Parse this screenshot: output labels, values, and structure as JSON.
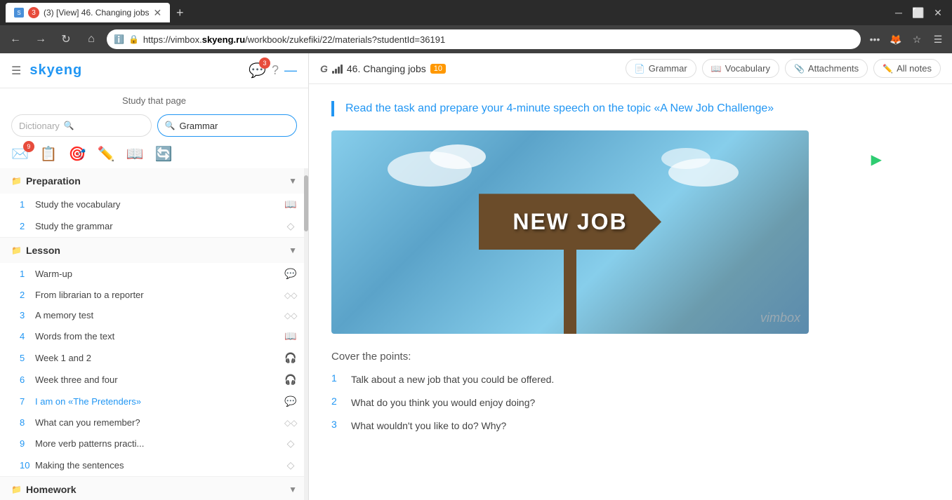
{
  "browser": {
    "tab_badge": "3",
    "tab_title": "(3) [View] 46. Changing jobs",
    "url_full": "https://vimbox.skyeng.ru/workbook/zukefiki/22/materials?studentId=36191",
    "url_domain": "skyeng.ru",
    "url_protocol": "https://vimbox.",
    "url_path": "/workbook/zukefiki/22/materials?studentId=36191"
  },
  "sidebar": {
    "logo": "skyeng",
    "chat_badge": "3",
    "study_label": "Study that page",
    "dictionary_placeholder": "Dictionary",
    "grammar_active": "Grammar",
    "sections": [
      {
        "title": "Preparation",
        "items": [
          {
            "num": "1",
            "name": "Study the vocabulary",
            "icon": "📖"
          },
          {
            "num": "2",
            "name": "Study the grammar",
            "icon": "◇"
          }
        ]
      },
      {
        "title": "Lesson",
        "items": [
          {
            "num": "1",
            "name": "Warm-up",
            "icon": "💬"
          },
          {
            "num": "2",
            "name": "From librarian to a reporter",
            "icon": "◇◇"
          },
          {
            "num": "3",
            "name": "A memory test",
            "icon": "◇◇"
          },
          {
            "num": "4",
            "name": "Words from the text",
            "icon": "📖"
          },
          {
            "num": "5",
            "name": "Week 1 and 2",
            "icon": "🎧"
          },
          {
            "num": "6",
            "name": "Week three and four",
            "icon": "🎧"
          },
          {
            "num": "7",
            "name": "I am on «The Pretenders»",
            "icon": "💬",
            "highlighted": true
          },
          {
            "num": "8",
            "name": "What can you remember?",
            "icon": "◇◇"
          },
          {
            "num": "9",
            "name": "More verb patterns practi...",
            "icon": "◇"
          },
          {
            "num": "10",
            "name": "Making the sentences",
            "icon": "◇"
          }
        ]
      },
      {
        "title": "Homework",
        "items": []
      }
    ]
  },
  "topbar": {
    "g_label": "G",
    "lesson_number": "46. Changing jobs",
    "lesson_badge": "10",
    "tabs": [
      {
        "label": "Grammar",
        "icon": "📄"
      },
      {
        "label": "Vocabulary",
        "icon": "📖"
      },
      {
        "label": "Attachments",
        "icon": "📎"
      },
      {
        "label": "All notes",
        "icon": "✏️"
      }
    ]
  },
  "content": {
    "intro_text": "Read the task and prepare your 4-minute speech on the topic «A New Job Challenge»",
    "sign_text": "NEW JOB",
    "cover_title": "Cover the points:",
    "points": [
      {
        "num": "1",
        "text": "Talk about a new job that you could be offered."
      },
      {
        "num": "2",
        "text": "What do you think you would enjoy doing?"
      },
      {
        "num": "3",
        "text": "What wouldn't you like to do? Why?"
      }
    ],
    "watermark": "vimbox"
  }
}
